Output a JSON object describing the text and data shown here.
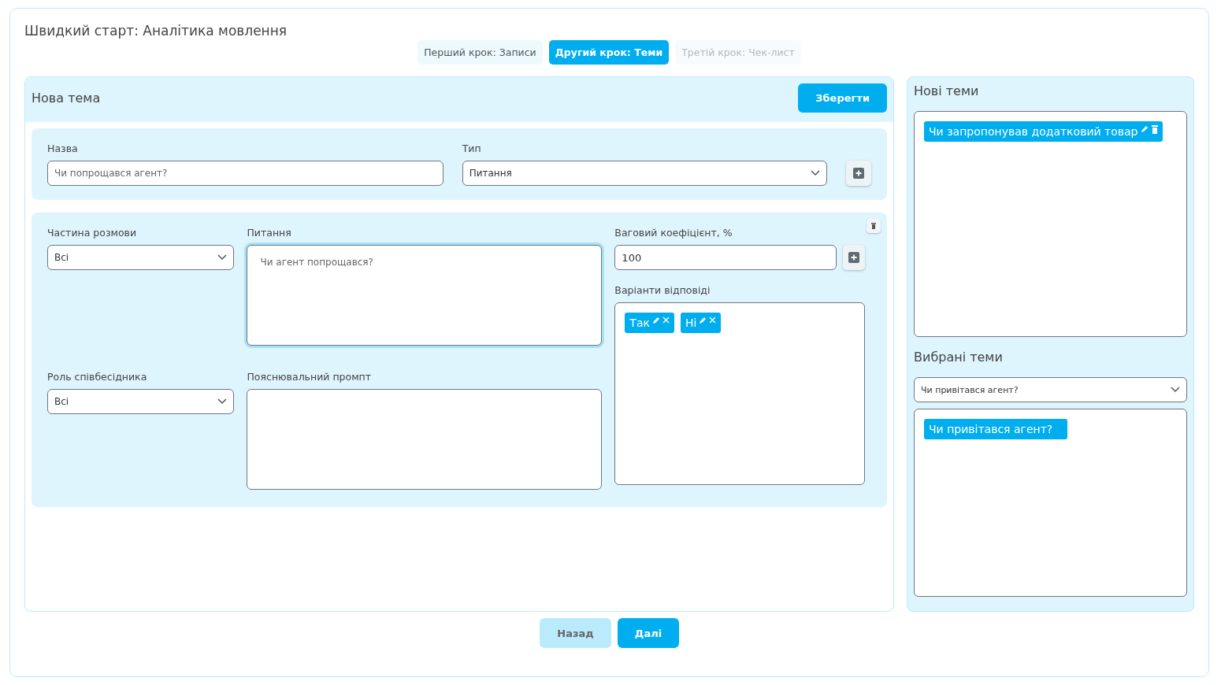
{
  "title": "Швидкий старт: Аналітика мовлення",
  "steps": [
    {
      "label": "Перший крок: Записи",
      "selected": false,
      "disabled": false
    },
    {
      "label": "Другий крок: Теми",
      "selected": true,
      "disabled": false
    },
    {
      "label": "Третій крок: Чек-лист",
      "selected": false,
      "disabled": true
    }
  ],
  "topic_editor": {
    "title": "Нова тема",
    "save_button": "Зберегти",
    "name": {
      "label": "Назва",
      "placeholder": "Чи попрощався агент?"
    },
    "type": {
      "label": "Тип",
      "value": "Питання"
    },
    "conversation_part": {
      "label": "Частина розмови",
      "value": "Всі"
    },
    "question": {
      "label": "Питання",
      "placeholder": "Чи агент попрощався?",
      "focused": true
    },
    "weight": {
      "label": "Ваговий коефіцієнт, %",
      "value": "100"
    },
    "answer_options": {
      "label": "Варіанти відповіді",
      "items": [
        "Так",
        "Ні"
      ]
    },
    "interlocutor_role": {
      "label": "Роль співбесідника",
      "value": "Всі"
    },
    "explanatory_prompt": {
      "label": "Пояснювальний промпт"
    }
  },
  "new_topics": {
    "title": "Нові теми",
    "items": [
      "Чи запропонував додатковий товар"
    ]
  },
  "selected_topics": {
    "title": "Вибрані теми",
    "dropdown": "Чи привітався агент?",
    "items": [
      "Чи привітався агент?"
    ]
  },
  "buttons": {
    "back": "Назад",
    "next": "Далі"
  }
}
